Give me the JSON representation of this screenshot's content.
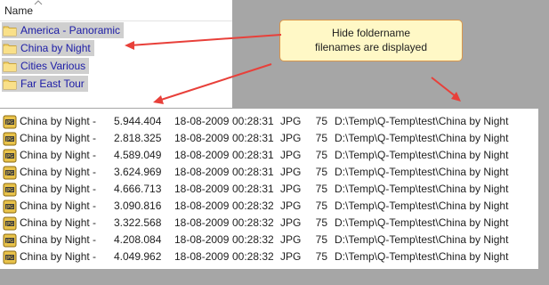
{
  "folder_pane": {
    "column_header": "Name",
    "folders": [
      "America  - Panoramic",
      "China by Night",
      "Cities Various",
      "Far East Tour"
    ]
  },
  "callout": {
    "line1": "Hide foldername",
    "line2": "filenames are displayed",
    "background": "#fff8c6",
    "border": "#d9964c"
  },
  "arrow_color": "#e8403a",
  "files": [
    {
      "name": "China by Night -",
      "size": "5.944.404",
      "date": "18-08-2009",
      "time": "00:28:31",
      "type": "JPG",
      "num": "75",
      "path": "D:\\Temp\\Q-Temp\\test\\China by Night"
    },
    {
      "name": "China by Night -",
      "size": "2.818.325",
      "date": "18-08-2009",
      "time": "00:28:31",
      "type": "JPG",
      "num": "75",
      "path": "D:\\Temp\\Q-Temp\\test\\China by Night"
    },
    {
      "name": "China by Night -",
      "size": "4.589.049",
      "date": "18-08-2009",
      "time": "00:28:31",
      "type": "JPG",
      "num": "75",
      "path": "D:\\Temp\\Q-Temp\\test\\China by Night"
    },
    {
      "name": "China by Night -",
      "size": "3.624.969",
      "date": "18-08-2009",
      "time": "00:28:31",
      "type": "JPG",
      "num": "75",
      "path": "D:\\Temp\\Q-Temp\\test\\China by Night"
    },
    {
      "name": "China by Night -",
      "size": "4.666.713",
      "date": "18-08-2009",
      "time": "00:28:31",
      "type": "JPG",
      "num": "75",
      "path": "D:\\Temp\\Q-Temp\\test\\China by Night"
    },
    {
      "name": "China by Night -",
      "size": "3.090.816",
      "date": "18-08-2009",
      "time": "00:28:32",
      "type": "JPG",
      "num": "75",
      "path": "D:\\Temp\\Q-Temp\\test\\China by Night"
    },
    {
      "name": "China by Night -",
      "size": "3.322.568",
      "date": "18-08-2009",
      "time": "00:28:32",
      "type": "JPG",
      "num": "75",
      "path": "D:\\Temp\\Q-Temp\\test\\China by Night"
    },
    {
      "name": "China by Night -",
      "size": "4.208.084",
      "date": "18-08-2009",
      "time": "00:28:32",
      "type": "JPG",
      "num": "75",
      "path": "D:\\Temp\\Q-Temp\\test\\China by Night"
    },
    {
      "name": "China by Night -",
      "size": "4.049.962",
      "date": "18-08-2009",
      "time": "00:28:32",
      "type": "JPG",
      "num": "75",
      "path": "D:\\Temp\\Q-Temp\\test\\China by Night"
    }
  ]
}
